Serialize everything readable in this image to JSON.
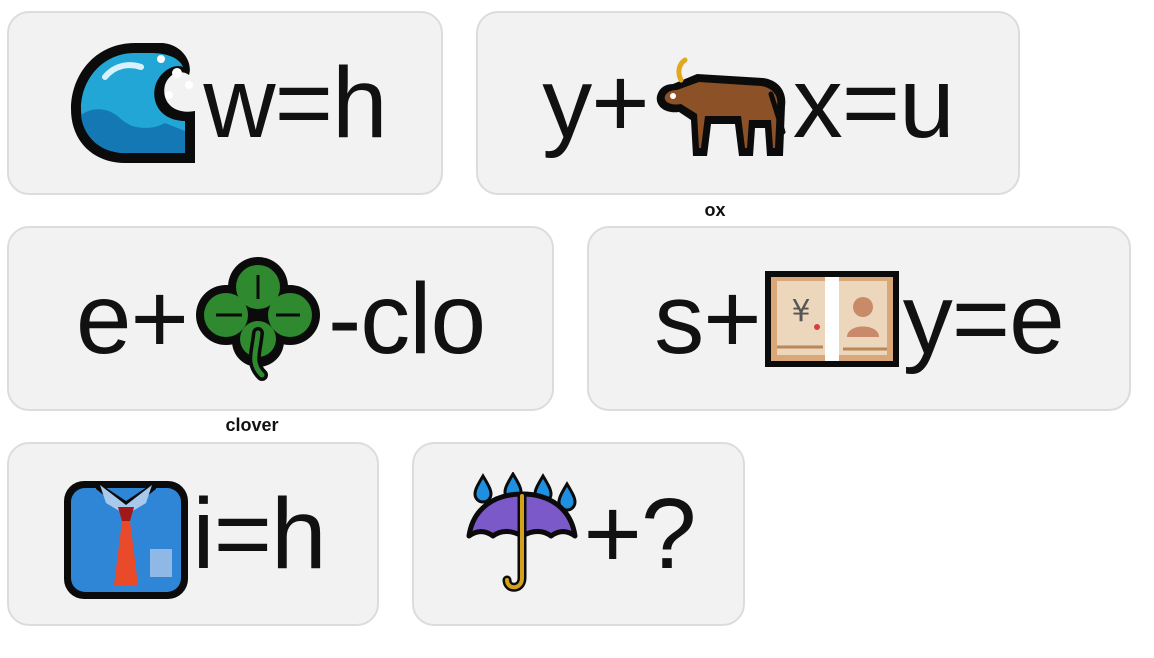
{
  "puzzles": [
    {
      "icon": "water-wave-icon",
      "parts": [
        "",
        "w=h"
      ],
      "caption": ""
    },
    {
      "icon": "ox-icon",
      "parts": [
        "y+",
        "x=u"
      ],
      "caption": "ox"
    },
    {
      "icon": "clover-icon",
      "parts": [
        "e+",
        " -clo"
      ],
      "caption": "clover"
    },
    {
      "icon": "yen-banknote-icon",
      "parts": [
        "s+",
        "y=e"
      ],
      "caption": ""
    },
    {
      "icon": "shirt-tie-icon",
      "parts": [
        "",
        "i=h"
      ],
      "caption": ""
    },
    {
      "icon": "umbrella-rain-icon",
      "parts": [
        "",
        "+?"
      ],
      "caption": ""
    }
  ],
  "colors": {
    "card_bg": "#f2f2f2",
    "card_border": "#dcdcdc",
    "text": "#111111"
  }
}
